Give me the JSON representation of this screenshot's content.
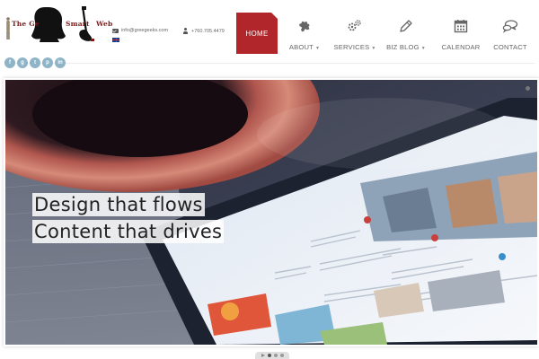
{
  "site": {
    "logo_text_part1": "The Ge",
    "logo_text_part2": "Smart",
    "logo_text_part3": "Web"
  },
  "contact": {
    "email": "info@greegeeks.com",
    "phone": "+760.705.4479",
    "language": "English"
  },
  "nav": {
    "home": "HOME",
    "about": "ABOUT",
    "services": "SERVICES",
    "blog": "BIZ BLOG",
    "calendar": "CALENDAR",
    "contact": "CONTACT",
    "caret": "▼"
  },
  "social": {
    "facebook": "f",
    "google": "g",
    "twitter": "t",
    "pinterest": "p",
    "linkedin": "in"
  },
  "hero": {
    "headline_line1": "Design that flows",
    "headline_line2": "Content that drives",
    "slide_count": 3,
    "active_slide": 1
  },
  "colors": {
    "accent": "#b0262a",
    "social": "#8fb4c8",
    "nav_text": "#666666"
  },
  "icons": {
    "about": "puzzle-icon",
    "services": "gears-icon",
    "blog": "pen-icon",
    "calendar": "calendar-icon",
    "contact": "speech-bubbles-icon"
  }
}
